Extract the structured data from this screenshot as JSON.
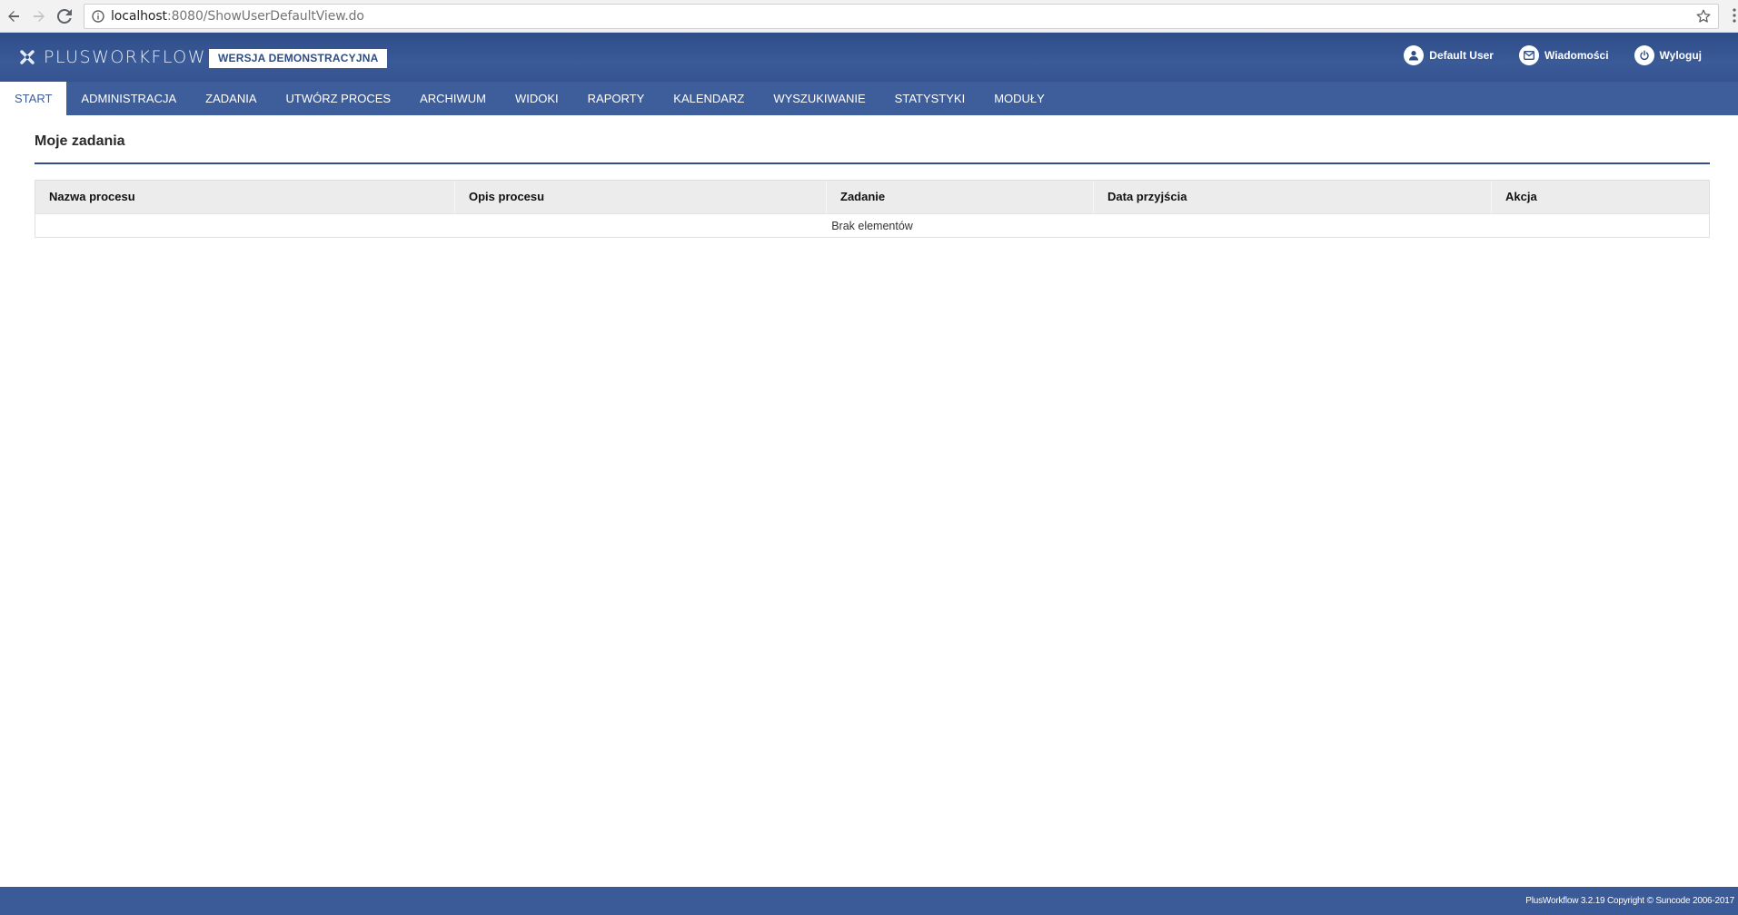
{
  "browser": {
    "url_host": "localhost",
    "url_path": ":8080/ShowUserDefaultView.do"
  },
  "header": {
    "logo_text": "PLUSWORKFLOW",
    "demo_badge": "WERSJA DEMONSTRACYJNA",
    "user_label": "Default User",
    "messages_label": "Wiadomości",
    "logout_label": "Wyloguj"
  },
  "nav": {
    "items": [
      {
        "label": "START",
        "active": true
      },
      {
        "label": "ADMINISTRACJA"
      },
      {
        "label": "ZADANIA"
      },
      {
        "label": "UTWÓRZ PROCES"
      },
      {
        "label": "ARCHIWUM"
      },
      {
        "label": "WIDOKI"
      },
      {
        "label": "RAPORTY"
      },
      {
        "label": "KALENDARZ"
      },
      {
        "label": "WYSZUKIWANIE"
      },
      {
        "label": "STATYSTYKI"
      },
      {
        "label": "MODUŁY"
      }
    ]
  },
  "main": {
    "title": "Moje zadania",
    "table": {
      "columns": [
        "Nazwa procesu",
        "Opis procesu",
        "Zadanie",
        "Data przyjścia",
        "Akcja"
      ],
      "empty_text": "Brak elementów"
    }
  },
  "footer": {
    "text": "PlusWorkflow 3.2.19 Copyright © Suncode 2006-2017"
  },
  "colors": {
    "brand": "#3d5d9b",
    "header": "#2e4d87"
  }
}
